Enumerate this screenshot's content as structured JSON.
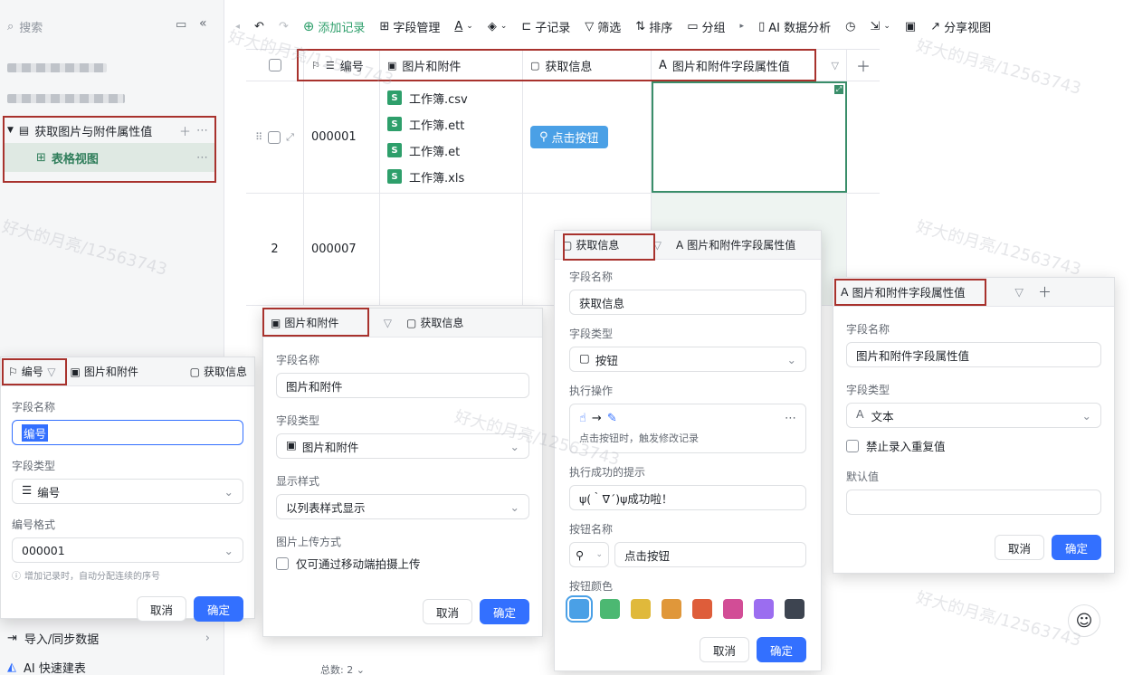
{
  "sidebar": {
    "search_placeholder": "搜索",
    "table_name": "获取图片与附件属性值",
    "view_name": "表格视图",
    "import_label": "导入/同步数据",
    "ai_label": "AI 快速建表"
  },
  "toolbar": {
    "add_record": "添加记录",
    "field_manage": "字段管理",
    "sub_record": "子记录",
    "filter": "筛选",
    "sort": "排序",
    "group": "分组",
    "ai_analysis": "AI 数据分析",
    "share_view": "分享视图"
  },
  "grid": {
    "headers": [
      "编号",
      "图片和附件",
      "获取信息",
      "图片和附件字段属性值"
    ],
    "rows": [
      {
        "index": "",
        "id": "000001",
        "files": [
          "工作簿.csv",
          "工作簿.ett",
          "工作簿.et",
          "工作簿.xls"
        ],
        "button": "点击按钮"
      },
      {
        "index": "2",
        "id": "000007",
        "files": [],
        "button": ""
      }
    ],
    "total": "总数: 2"
  },
  "panel_number": {
    "tabs": [
      "编号",
      "图片和附件",
      "获取信息"
    ],
    "name_label": "字段名称",
    "name_value": "编号",
    "type_label": "字段类型",
    "type_value": "编号",
    "format_label": "编号格式",
    "format_value": "000001",
    "hint": "增加记录时，自动分配连续的序号",
    "cancel": "取消",
    "confirm": "确定"
  },
  "panel_attachment": {
    "tabs": [
      "图片和附件",
      "获取信息"
    ],
    "name_label": "字段名称",
    "name_value": "图片和附件",
    "type_label": "字段类型",
    "type_value": "图片和附件",
    "style_label": "显示样式",
    "style_value": "以列表样式显示",
    "upload_label": "图片上传方式",
    "upload_option": "仅可通过移动端拍摄上传",
    "cancel": "取消",
    "confirm": "确定"
  },
  "panel_button": {
    "tabs": [
      "获取信息",
      "图片和附件字段属性值"
    ],
    "name_label": "字段名称",
    "name_value": "获取信息",
    "type_label": "字段类型",
    "type_value": "按钮",
    "action_label": "执行操作",
    "action_desc": "点击按钮时，触发修改记录",
    "success_label": "执行成功的提示",
    "success_value": "ψ(｀∇´)ψ成功啦！",
    "btnname_label": "按钮名称",
    "btnname_value": "点击按钮",
    "color_label": "按钮颜色",
    "colors": [
      "#4aa0e6",
      "#4cb872",
      "#e0b93b",
      "#e0973a",
      "#de5d3a",
      "#d24d96",
      "#9b6df0",
      "#3d4450"
    ],
    "cancel": "取消",
    "confirm": "确定"
  },
  "panel_text": {
    "tab": "图片和附件字段属性值",
    "name_label": "字段名称",
    "name_value": "图片和附件字段属性值",
    "type_label": "字段类型",
    "type_value": "文本",
    "dup_option": "禁止录入重复值",
    "default_label": "默认值",
    "cancel": "取消",
    "confirm": "确定"
  },
  "watermark": "好大的月亮/12563743"
}
